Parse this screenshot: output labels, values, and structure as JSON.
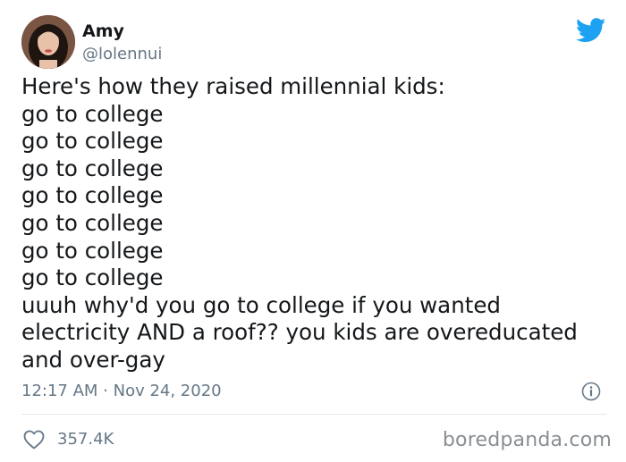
{
  "author": {
    "display_name": "Amy",
    "handle": "@lolennui",
    "avatar_icon": "user-avatar"
  },
  "brand": {
    "icon": "twitter-bird-icon",
    "color": "#1da1f2"
  },
  "tweet": {
    "lines": [
      "Here's how they raised millennial kids:",
      "go to college",
      "go to college",
      "go to college",
      "go to college",
      "go to college",
      "go to college",
      "go to college",
      "uuuh why'd you go to college if you wanted",
      "electricity AND a roof?? you kids are overeducated",
      "and over-gay"
    ],
    "timestamp": "12:17 AM · Nov 24, 2020",
    "likes": "357.4K"
  },
  "icons": {
    "info": "info-icon",
    "like": "heart-icon"
  },
  "watermark": "boredpanda.com",
  "colors": {
    "text": "#14171a",
    "secondary": "#657786",
    "divider": "#e1e8ed"
  }
}
